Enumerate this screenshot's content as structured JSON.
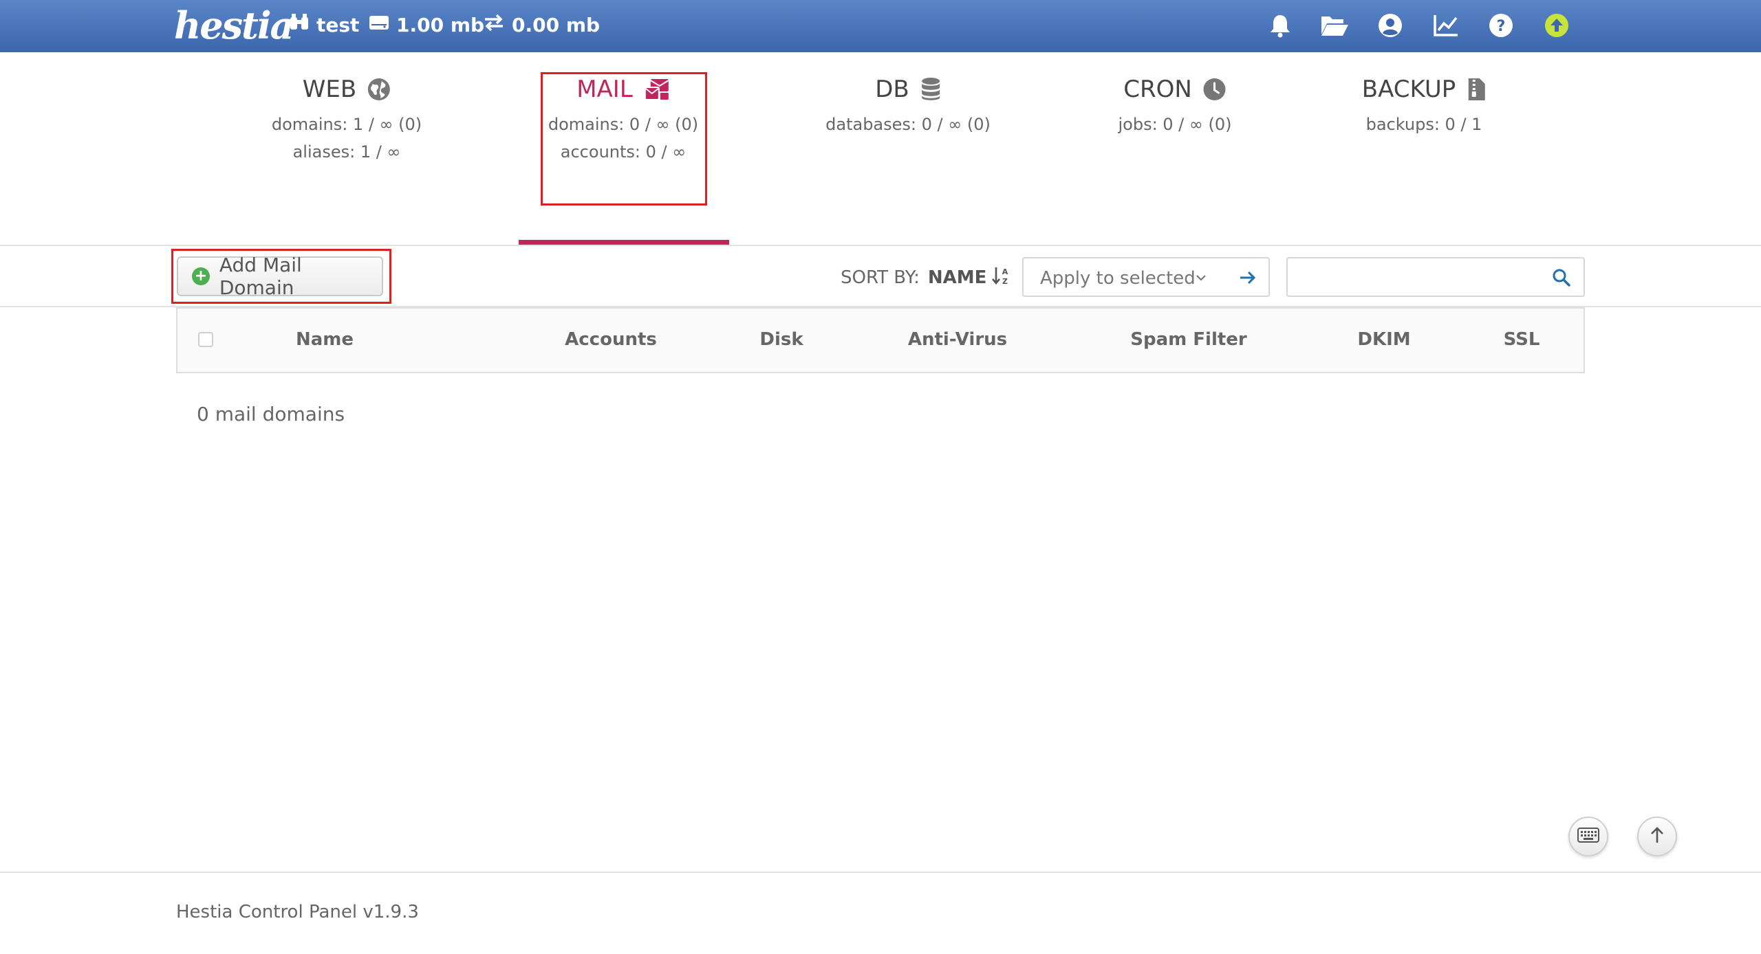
{
  "header": {
    "logo_text": "hestia",
    "user": "test",
    "disk_usage": "1.00 mb",
    "bandwidth_usage": "0.00 mb",
    "background_color": "#3d66ad",
    "icons": [
      "bell-icon",
      "folder-open-icon",
      "user-circle-icon",
      "chart-line-icon",
      "help-circle-icon",
      "update-arrow-icon"
    ]
  },
  "tabs": [
    {
      "label": "WEB",
      "icon": "globe-icon",
      "lines": [
        "domains: 1 / ∞ (0)",
        "aliases: 1 / ∞"
      ]
    },
    {
      "label": "MAIL",
      "icon": "mail-bulk-icon",
      "lines": [
        "domains: 0 / ∞ (0)",
        "accounts: 0 / ∞"
      ],
      "active": true
    },
    {
      "label": "DB",
      "icon": "database-icon",
      "lines": [
        "databases: 0 / ∞ (0)"
      ]
    },
    {
      "label": "CRON",
      "icon": "clock-icon",
      "lines": [
        "jobs: 0 / ∞ (0)"
      ]
    },
    {
      "label": "BACKUP",
      "icon": "file-zipper-icon",
      "lines": [
        "backups: 0 / 1"
      ]
    }
  ],
  "accent_color": "#c2255c",
  "toolbar": {
    "add_button_label": "Add Mail Domain",
    "sort_by_label": "SORT BY:",
    "sort_by_value": "NAME",
    "apply_select_value": "Apply to selected",
    "search_placeholder": ""
  },
  "table": {
    "columns": [
      "Name",
      "Accounts",
      "Disk",
      "Anti-Virus",
      "Spam Filter",
      "DKIM",
      "SSL"
    ],
    "rows": [],
    "empty_message": "0 mail domains"
  },
  "footer": {
    "version_text": "Hestia Control Panel v1.9.3"
  }
}
